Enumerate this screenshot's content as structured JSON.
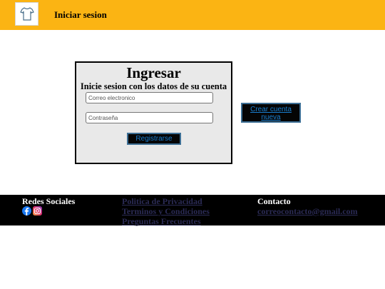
{
  "header": {
    "title": "Iniciar sesion",
    "logo_icon": "shirt-logo-icon",
    "background": "#fbb413"
  },
  "login": {
    "title": "Ingresar",
    "subtitle": "Inicie sesion con los datos de su cuenta",
    "email_placeholder": "Correo electronico",
    "password_placeholder": "Contraseña",
    "register_label": "Registrarse"
  },
  "create_account": {
    "label": "Crear cuenta nueva"
  },
  "footer": {
    "social_title": "Redes Sociales",
    "social_icons": [
      "facebook-icon",
      "instagram-icon"
    ],
    "links": {
      "privacy": "Politica de Privacidad",
      "terms": "Terminos y Condiciones",
      "faq": "Preguntas Frecuentes"
    },
    "contact_title": "Contacto",
    "contact_email": "correocontacto@gmail.com"
  },
  "colors": {
    "accent": "#fbb413",
    "button_text": "#1a7fd0",
    "link": "#2b2b55"
  }
}
